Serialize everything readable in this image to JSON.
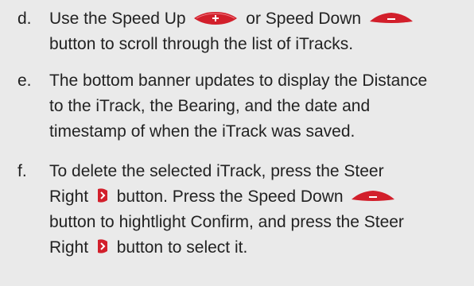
{
  "steps": [
    {
      "letter": "d.",
      "line1_a": "Use the Speed Up",
      "line1_b": "or Speed Down",
      "line2": "button to scroll through the list of iTracks."
    },
    {
      "letter": "e.",
      "line1": "The bottom banner updates to display the Distance",
      "line2": "to the iTrack, the Bearing, and the date and",
      "line3": "timestamp of when the iTrack was saved."
    },
    {
      "letter": "f.",
      "line1": "To delete the selected iTrack, press the Steer",
      "line2_a": "Right",
      "line2_b": "button. Press the Speed Down",
      "line3": "button to hightlight Confirm, and press the Steer",
      "line4_a": "Right",
      "line4_b": "button to select it."
    }
  ],
  "icons": {
    "speed_up": "speed-up-icon",
    "speed_down": "speed-down-icon",
    "steer_right": "steer-right-icon"
  },
  "colors": {
    "icon_red": "#d21f2b",
    "icon_dark_red": "#9e1218",
    "text": "#222222",
    "background": "#eaeaea"
  }
}
